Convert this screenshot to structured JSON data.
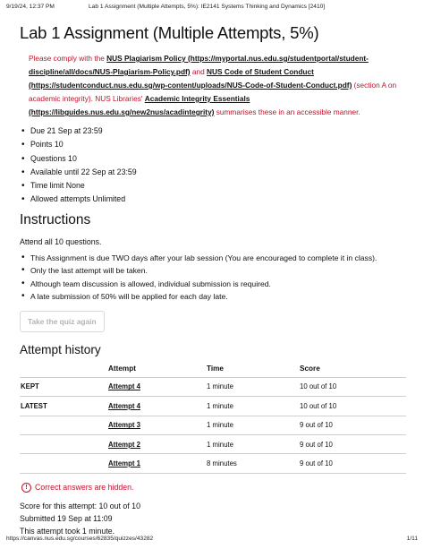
{
  "print": {
    "header_datetime": "9/19/24, 12:37 PM",
    "header_title": "Lab 1 Assignment (Multiple Attempts, 5%): IE2141 Systems Thinking and Dynamics [2410]",
    "footer_url": "https://canvas.nus.edu.sg/courses/62835/quizzes/43282",
    "footer_page": "1/11"
  },
  "page": {
    "title": "Lab 1 Assignment (Multiple Attempts, 5%)"
  },
  "notice": {
    "p1": "Please comply with the ",
    "plagiarism_link": "NUS Plagiarism Policy",
    "plagiarism_url": " (https://myportal.nus.edu.sg/studentportal/student-discipline/all/docs/NUS-Plagiarism-Policy.pdf)",
    "p2": " and ",
    "conduct_link": "NUS Code of Student Conduct",
    "conduct_url": " (https://studentconduct.nus.edu.sg/wp-content/uploads/NUS-Code-of-Student-Conduct.pdf)",
    "p3": " (section A on academic integrity). NUS Libraries' ",
    "integrity_link": "Academic Integrity Essentials",
    "integrity_url": " (https://libguides.nus.edu.sg/new2nus/acadintegrity)",
    "p4": " summarises these in an accessible manner."
  },
  "details": {
    "due": "Due 21 Sep at 23:59",
    "points": "Points 10",
    "questions": "Questions 10",
    "available": "Available until 22 Sep at 23:59",
    "time_limit": "Time limit None",
    "attempts": "Allowed attempts Unlimited"
  },
  "instructions": {
    "heading": "Instructions",
    "intro": "Attend all 10 questions.",
    "items": [
      "This Assignment is due TWO days after your lab session (You are encouraged to complete it in class).",
      "Only the last attempt will be taken.",
      "Although team discussion is allowed, individual submission is required.",
      "A late submission of 50% will be applied for each day late."
    ]
  },
  "actions": {
    "take_quiz": "Take the quiz again"
  },
  "history": {
    "heading": "Attempt history",
    "columns": [
      "",
      "Attempt",
      "Time",
      "Score"
    ],
    "rows": [
      {
        "label": "KEPT",
        "attempt": "Attempt 4",
        "time": "1 minute",
        "score": "10 out of 10"
      },
      {
        "label": "LATEST",
        "attempt": "Attempt 4",
        "time": "1 minute",
        "score": "10 out of 10"
      },
      {
        "label": "",
        "attempt": "Attempt 3",
        "time": "1 minute",
        "score": "9 out of 10"
      },
      {
        "label": "",
        "attempt": "Attempt 2",
        "time": "1 minute",
        "score": "9 out of 10"
      },
      {
        "label": "",
        "attempt": "Attempt 1",
        "time": "8 minutes",
        "score": "9 out of 10"
      }
    ]
  },
  "result": {
    "hidden_note": "Correct answers are hidden.",
    "score": "Score for this attempt: 10 out of 10",
    "submitted": "Submitted 19 Sep at 11:09",
    "duration": "This attempt took 1 minute."
  },
  "colors": {
    "notice_red": "#c0132a",
    "text": "#111111",
    "button_disabled_text": "#b4b4b4"
  },
  "icons": {
    "hidden_note": "info-circle-icon"
  }
}
